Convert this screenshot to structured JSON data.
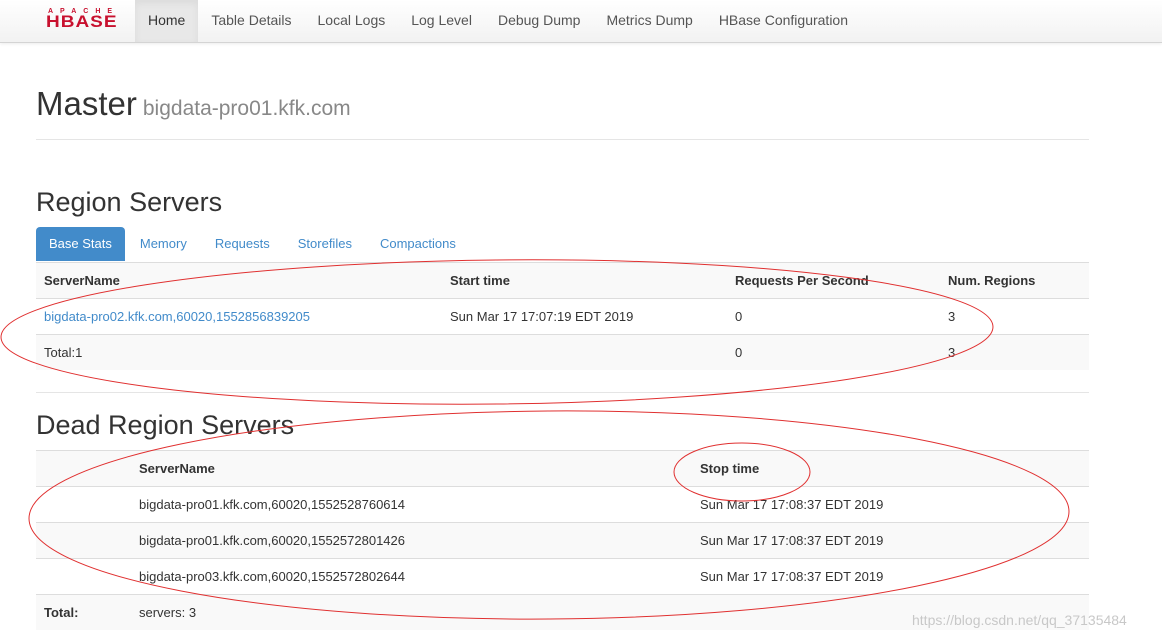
{
  "brand": {
    "small": "APACHE",
    "big": "HBASE"
  },
  "nav": {
    "items": [
      {
        "label": "Home"
      },
      {
        "label": "Table Details"
      },
      {
        "label": "Local Logs"
      },
      {
        "label": "Log Level"
      },
      {
        "label": "Debug Dump"
      },
      {
        "label": "Metrics Dump"
      },
      {
        "label": "HBase Configuration"
      }
    ],
    "active_index": 0
  },
  "header": {
    "title": "Master",
    "host": "bigdata-pro01.kfk.com"
  },
  "region_servers": {
    "heading": "Region Servers",
    "tabs": [
      "Base Stats",
      "Memory",
      "Requests",
      "Storefiles",
      "Compactions"
    ],
    "active_tab_index": 0,
    "columns": [
      "ServerName",
      "Start time",
      "Requests Per Second",
      "Num. Regions"
    ],
    "rows": [
      {
        "server": "bigdata-pro02.kfk.com,60020,1552856839205",
        "start": "Sun Mar 17 17:07:19 EDT 2019",
        "rps": "0",
        "regions": "3"
      }
    ],
    "total": {
      "label": "Total:1",
      "rps": "0",
      "regions": "3"
    }
  },
  "dead_region_servers": {
    "heading": "Dead Region Servers",
    "columns": [
      "ServerName",
      "Stop time"
    ],
    "rows": [
      {
        "server": "bigdata-pro01.kfk.com,60020,1552528760614",
        "stop": "Sun Mar 17 17:08:37 EDT 2019"
      },
      {
        "server": "bigdata-pro01.kfk.com,60020,1552572801426",
        "stop": "Sun Mar 17 17:08:37 EDT 2019"
      },
      {
        "server": "bigdata-pro03.kfk.com,60020,1552572802644",
        "stop": "Sun Mar 17 17:08:37 EDT 2019"
      }
    ],
    "total": {
      "label": "Total:",
      "value": "servers: 3"
    }
  },
  "watermark": "https://blog.csdn.net/qq_37135484",
  "colors": {
    "link": "#428bca",
    "annotation": "#e03030",
    "brand": "#c8102e"
  }
}
